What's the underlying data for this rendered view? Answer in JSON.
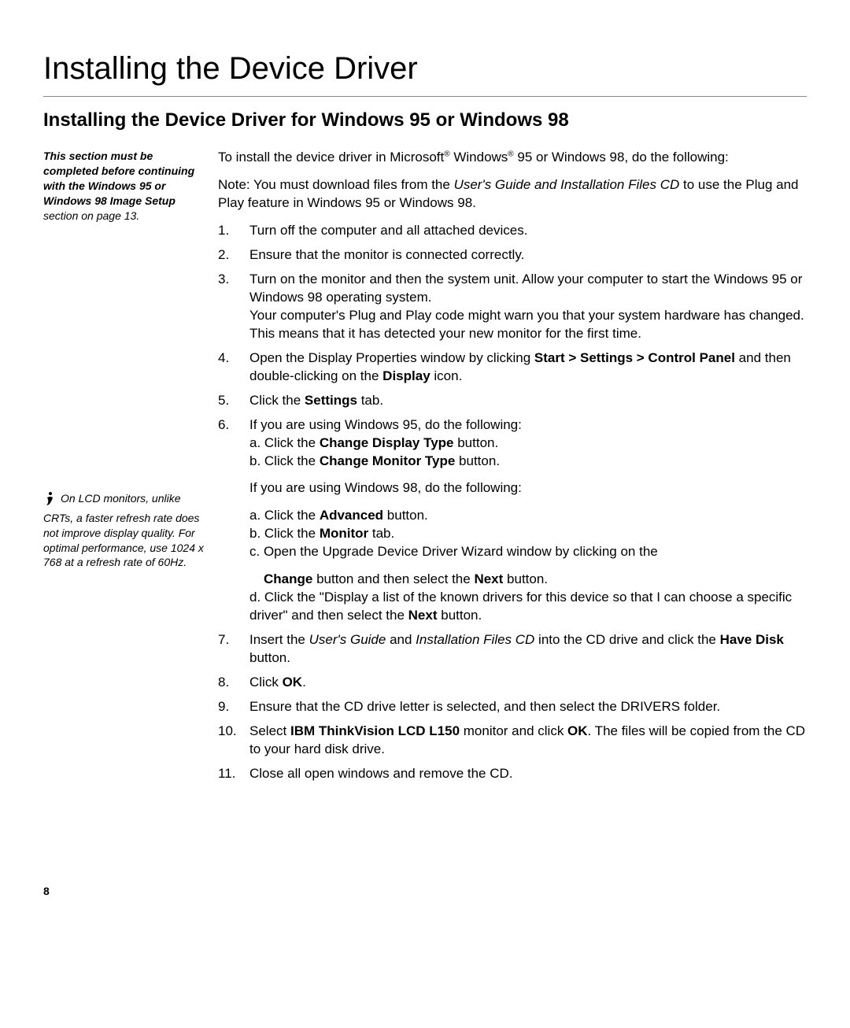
{
  "title": "Installing the Device Driver",
  "subtitle": "Installing the Device Driver for Windows 95 or Windows 98",
  "sidebar": {
    "note1_a": "This section must be completed before continuing with the Windows 95 or Windows 98 Image Setup",
    "note1_b": " section on page 13.",
    "note2_a": "On LCD monitors, unlike CRTs, a faster refresh rate does not improve display quality. For optimal performance, use 1024 x 768 at a refresh rate of 60Hz."
  },
  "intro": {
    "pre": "To install the device driver in Microsoft",
    "reg": "®",
    "mid": " Windows",
    "post": " 95 or Windows 98, do the following:"
  },
  "note_line": {
    "pre": "Note: You must download files from the ",
    "italic": "User's Guide and Installation Files CD",
    "post": " to use the Plug and Play feature in Windows 95 or Windows 98."
  },
  "steps": {
    "s1": "Turn off the computer and all attached devices.",
    "s2": "Ensure that the monitor is connected correctly.",
    "s3": "Turn on the monitor and then the system unit. Allow your computer to start the Windows 95 or Windows 98 operating system.\nYour computer's Plug and Play code might warn you that your system hardware has changed. This means that it has detected your new monitor for the first time.",
    "s4_pre": "Open the Display Properties window by clicking ",
    "s4_b1": "Start > Settings > Control Panel",
    "s4_mid": " and then double-clicking on the ",
    "s4_b2": "Display",
    "s4_post": " icon.",
    "s5_pre": "Click the ",
    "s5_b": "Settings",
    "s5_post": " tab.",
    "s6_intro95": "If you are using Windows 95, do the following:",
    "s6_a_pre": "a. Click the ",
    "s6_a_b": "Change Display Type",
    "s6_a_post": " button.",
    "s6_b_pre": "b. Click the ",
    "s6_b_b": "Change Monitor Type",
    "s6_b_post": " button.",
    "s6_intro98": "If you are using Windows 98, do the following:",
    "s6_98a_pre": "a. Click the ",
    "s6_98a_b": "Advanced",
    "s6_98a_post": " button.",
    "s6_98b_pre": "b. Click the ",
    "s6_98b_b": "Monitor",
    "s6_98b_post": " tab.",
    "s6_98c": "c. Open the Upgrade Device Driver Wizard window by clicking on the",
    "s6_98c2_b1": "Change",
    "s6_98c2_mid": " button and then select the ",
    "s6_98c2_b2": "Next",
    "s6_98c2_post": " button.",
    "s6_98d_pre": "d. Click the \"Display a list of the known drivers for this device so that I can choose a specific driver\" and then select the ",
    "s6_98d_b": "Next",
    "s6_98d_post": " button.",
    "s7_pre": "Insert the ",
    "s7_i1": "User's Guide",
    "s7_mid1": " and ",
    "s7_i2": "Installation Files CD",
    "s7_mid2": " into the CD drive and click the ",
    "s7_b": "Have Disk",
    "s7_post": " button.",
    "s8_pre": "Click ",
    "s8_b": "OK",
    "s8_post": ".",
    "s9": "Ensure that the CD drive letter is selected, and then select the DRIVERS folder.",
    "s10_pre": "Select ",
    "s10_b1": "IBM ThinkVision LCD L150",
    "s10_mid": " monitor and click ",
    "s10_b2": "OK",
    "s10_post": ". The files will be copied from the CD to your hard disk drive.",
    "s11": "Close all open windows and remove the CD."
  },
  "pagenum": "8"
}
